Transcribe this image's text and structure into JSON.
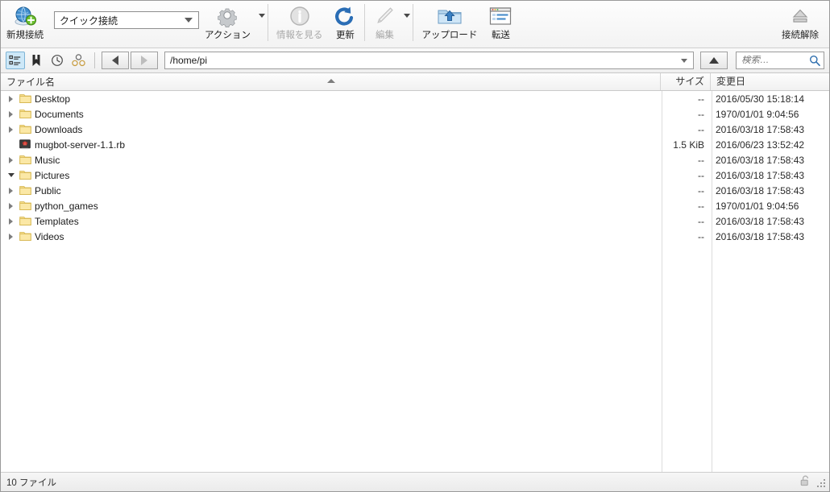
{
  "toolbar": {
    "new_connection": {
      "label": "新規接続",
      "icon": "globe-plus-icon"
    },
    "quick_connect": {
      "value": "クイック接続",
      "icon": "chevron-down-icon"
    },
    "action": {
      "label": "アクション",
      "icon": "gear-icon"
    },
    "get_info": {
      "label": "情報を見る",
      "icon": "info-icon"
    },
    "refresh": {
      "label": "更新",
      "icon": "refresh-icon"
    },
    "edit": {
      "label": "編集",
      "icon": "pencil-icon"
    },
    "upload": {
      "label": "アップロード",
      "icon": "folder-upload-icon"
    },
    "transfer": {
      "label": "転送",
      "icon": "transfer-window-icon"
    },
    "disconnect": {
      "label": "接続解除",
      "icon": "eject-icon"
    }
  },
  "navbar": {
    "view_tree": "tree-view-icon",
    "bookmarks": "bookmark-icon",
    "history": "clock-icon",
    "shares": "network-share-icon",
    "back": "back-arrow-icon",
    "forward": "forward-arrow-icon",
    "path": "/home/pi",
    "path_dropdown": "chevron-down-icon",
    "up": "up-arrow-icon",
    "search": {
      "placeholder": "検索…",
      "icon": "search-icon"
    }
  },
  "columns": {
    "name": "ファイル名",
    "size": "サイズ",
    "date": "変更日",
    "sort_direction": "ascending"
  },
  "files": [
    {
      "name": "Desktop",
      "size": "--",
      "date": "2016/05/30 15:18:14",
      "type": "folder",
      "expanded": false
    },
    {
      "name": "Documents",
      "size": "--",
      "date": "1970/01/01 9:04:56",
      "type": "folder",
      "expanded": false
    },
    {
      "name": "Downloads",
      "size": "--",
      "date": "2016/03/18 17:58:43",
      "type": "folder",
      "expanded": false
    },
    {
      "name": "mugbot-server-1.1.rb",
      "size": "1.5 KiB",
      "date": "2016/06/23 13:52:42",
      "type": "ruby",
      "expanded": null
    },
    {
      "name": "Music",
      "size": "--",
      "date": "2016/03/18 17:58:43",
      "type": "folder",
      "expanded": false
    },
    {
      "name": "Pictures",
      "size": "--",
      "date": "2016/03/18 17:58:43",
      "type": "folder",
      "expanded": true
    },
    {
      "name": "Public",
      "size": "--",
      "date": "2016/03/18 17:58:43",
      "type": "folder",
      "expanded": false
    },
    {
      "name": "python_games",
      "size": "--",
      "date": "1970/01/01 9:04:56",
      "type": "folder",
      "expanded": false
    },
    {
      "name": "Templates",
      "size": "--",
      "date": "2016/03/18 17:58:43",
      "type": "folder",
      "expanded": false
    },
    {
      "name": "Videos",
      "size": "--",
      "date": "2016/03/18 17:58:43",
      "type": "folder",
      "expanded": false
    }
  ],
  "statusbar": {
    "file_count": "10 ファイル",
    "lock": "unlocked-padlock-icon",
    "grip": "resize-grip-icon"
  },
  "colors": {
    "folder": "#f5d97a",
    "accent_blue": "#2f79b5",
    "badge_green": "#5aab2f",
    "selection": "#cde8f8"
  }
}
